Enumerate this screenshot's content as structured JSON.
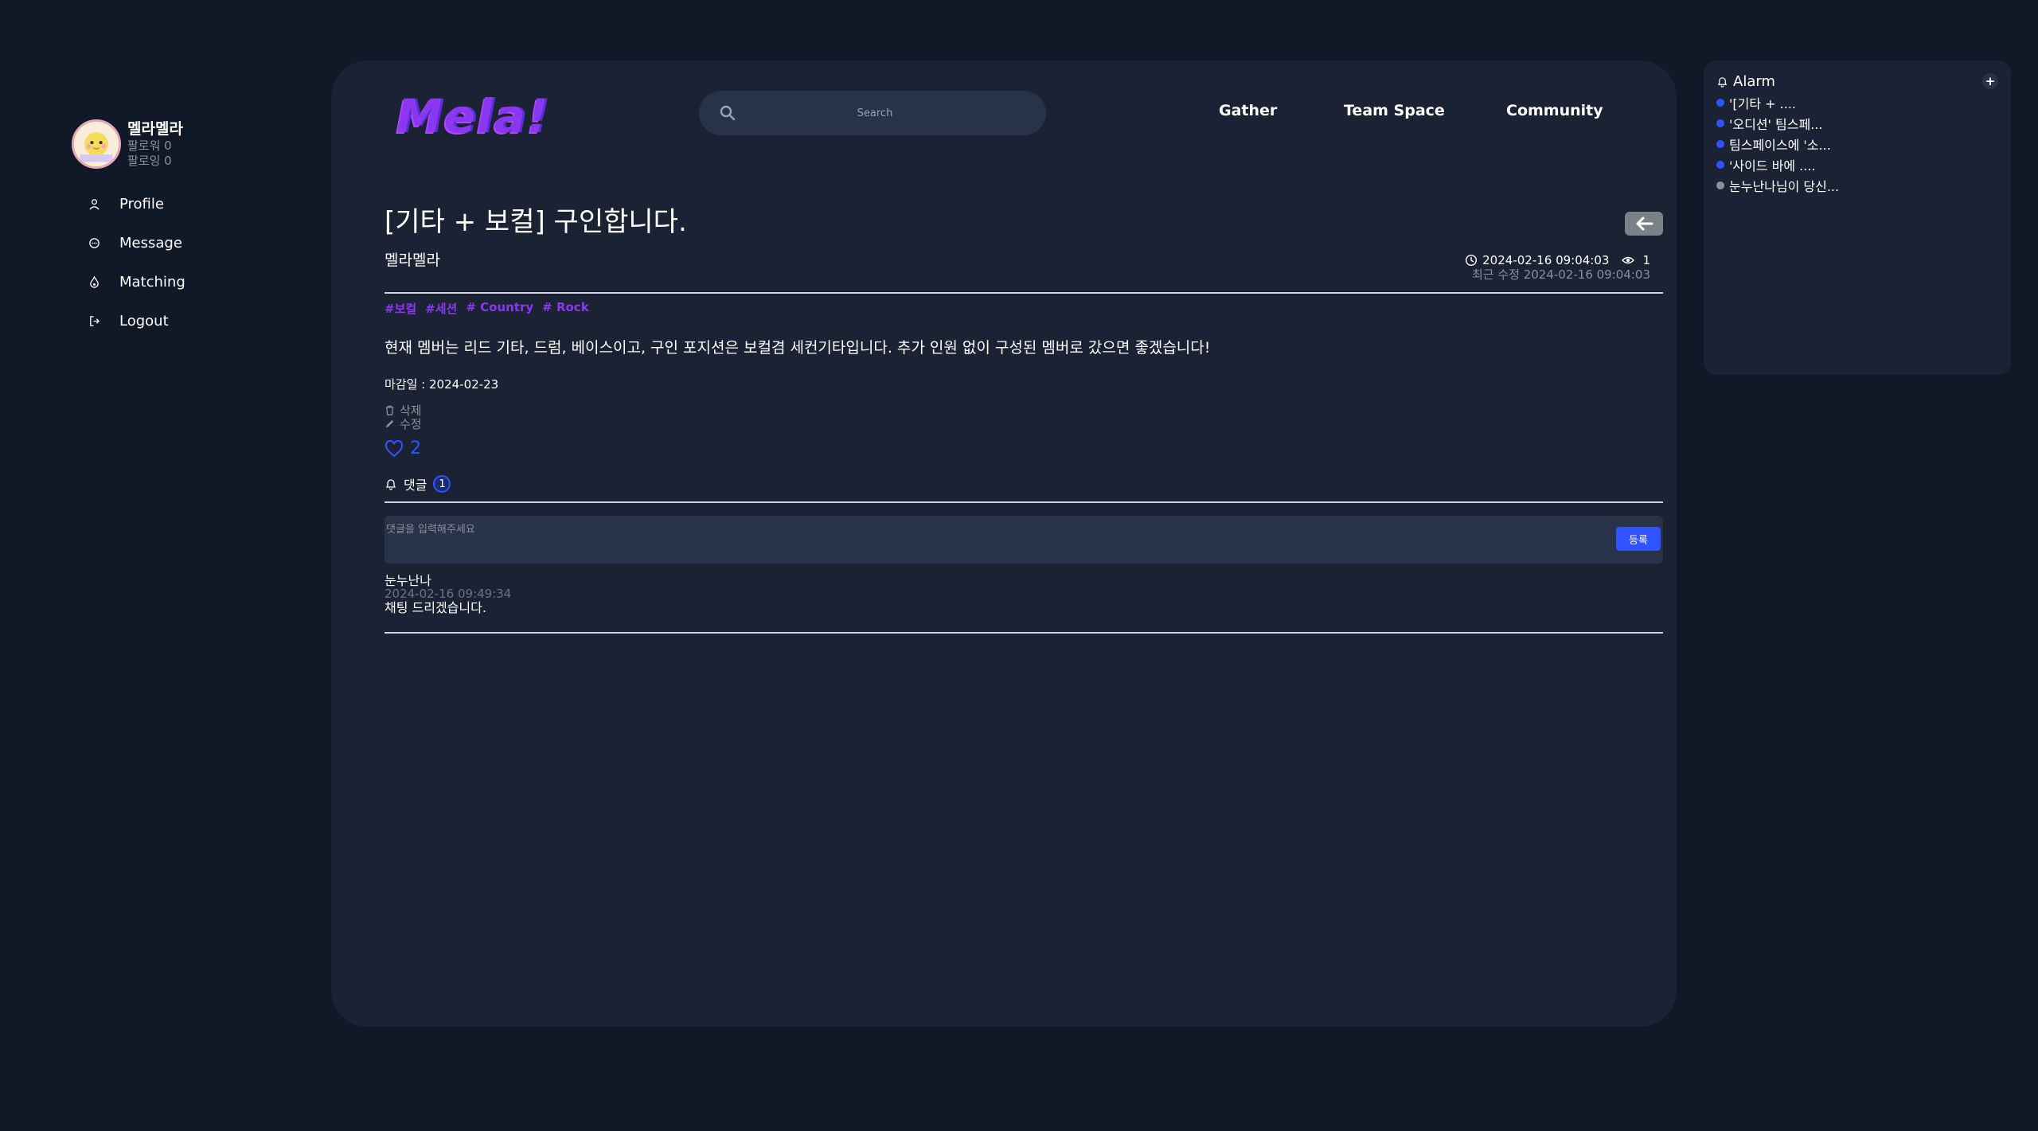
{
  "sidebar": {
    "user": {
      "name": "멜라멜라",
      "followers": "팔로워 0",
      "following": "팔로잉 0"
    },
    "items": [
      {
        "label": "Profile",
        "icon": "person-icon"
      },
      {
        "label": "Message",
        "icon": "chat-icon"
      },
      {
        "label": "Matching",
        "icon": "fire-icon"
      },
      {
        "label": "Logout",
        "icon": "logout-icon"
      }
    ]
  },
  "header": {
    "logo": "Mela!",
    "search_placeholder": "Search",
    "nav": [
      "Gather",
      "Team Space",
      "Community"
    ]
  },
  "post": {
    "title": "[기타 + 보컬] 구인합니다.",
    "author": "멜라멜라",
    "created": "2024-02-16 09:04:03",
    "views": "1",
    "modified": "최근 수정 2024-02-16 09:04:03",
    "tags": [
      "#보컬",
      "#세션",
      "# Country",
      "# Rock"
    ],
    "content": "현재 멤버는 리드 기타, 드럼, 베이스이고, 구인 포지션은 보컬겸 세컨기타입니다. 추가 인원 없이 구성된 멤버로 갔으면 좋겠습니다!",
    "deadline": "마감일 : 2024-02-23",
    "delete_label": "삭제",
    "edit_label": "수정",
    "likes": "2"
  },
  "comments": {
    "label": "댓글",
    "count": "1",
    "input_placeholder": "댓글을 입력해주세요",
    "submit_label": "등록",
    "items": [
      {
        "author": "눈누난나",
        "time": "2024-02-16 09:49:34",
        "text": "채팅 드리겠습니다."
      }
    ]
  },
  "alarm": {
    "title": "Alarm",
    "add_label": "+",
    "items": [
      {
        "text": "'[기타 + ....",
        "unread": true
      },
      {
        "text": "'오디션' 팀스페...",
        "unread": true
      },
      {
        "text": "팀스페이스에 '소...",
        "unread": true
      },
      {
        "text": "'사이드 바에 ....",
        "unread": true
      },
      {
        "text": "눈누난나님이 당신...",
        "unread": false
      }
    ]
  },
  "colors": {
    "background": "#111827",
    "card": "#1b2233",
    "accent": "#2f53ff",
    "brand": "#8a37f0",
    "muted": "#8a8f9b"
  }
}
